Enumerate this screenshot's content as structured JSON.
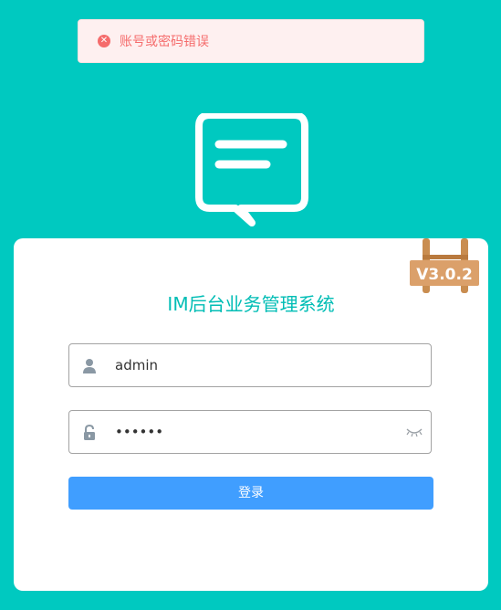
{
  "toast": {
    "icon": "error-circle-icon",
    "message": "账号或密码错误",
    "color": "#f56c6c"
  },
  "logo": {
    "icon": "chat-message-icon"
  },
  "version_badge": "V3.0.2",
  "login": {
    "title": "IM后台业务管理系统",
    "username": {
      "icon": "user-icon",
      "value": "admin"
    },
    "password": {
      "icon": "lock-icon",
      "value": "••••••",
      "toggle_icon": "eye-closed-icon"
    },
    "submit_label": "登录"
  },
  "colors": {
    "background": "#00c9c0",
    "accent": "#00bdb5",
    "button": "#409eff"
  }
}
